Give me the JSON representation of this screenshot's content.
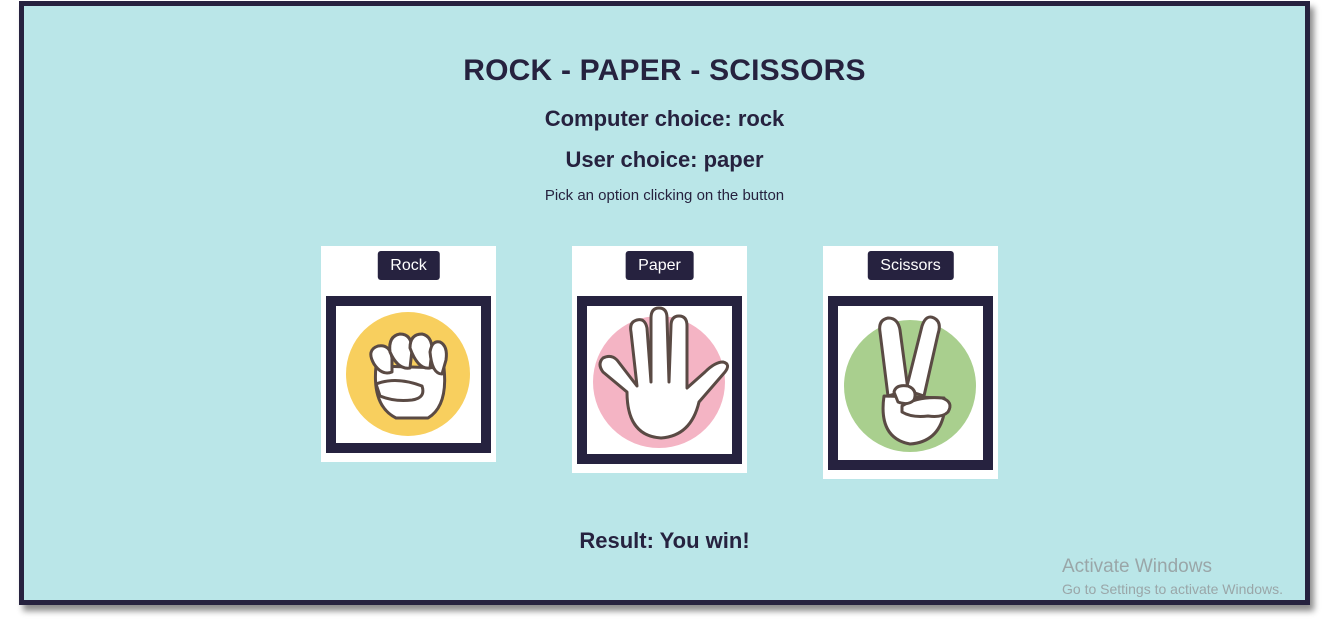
{
  "header": {
    "title": "ROCK - PAPER - SCISSORS",
    "computer_choice": "Computer choice: rock",
    "user_choice": "User choice: paper",
    "hint": "Pick an option clicking on the button"
  },
  "options": [
    {
      "label": "Rock",
      "icon": "fist-icon",
      "circle_color": "#f8cf5e"
    },
    {
      "label": "Paper",
      "icon": "open-hand-icon",
      "circle_color": "#f4b4c4"
    },
    {
      "label": "Scissors",
      "icon": "peace-hand-icon",
      "circle_color": "#a9cf8e"
    }
  ],
  "result": "Result: You win!",
  "watermark": {
    "line1": "Activate Windows",
    "line2": "Go to Settings to activate Windows."
  },
  "colors": {
    "background": "#bae6e8",
    "accent": "#26223f"
  }
}
